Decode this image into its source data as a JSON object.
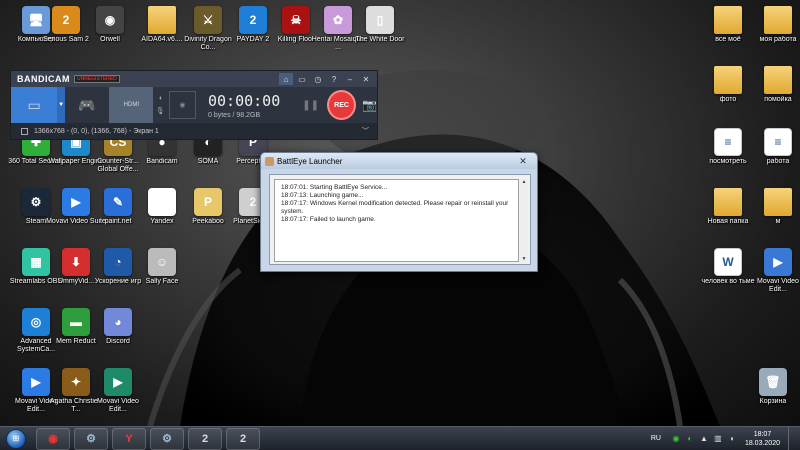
{
  "desktop": {
    "icons": [
      {
        "label": "Компьютер",
        "glyph": "🖥",
        "color": "#6a9bd8"
      },
      {
        "label": "Serious Sam 2",
        "glyph": "2",
        "color": "#d98a1b"
      },
      {
        "label": "Orwell",
        "glyph": "◉",
        "color": "#444"
      },
      {
        "label": "AIDA64.v6....",
        "glyph": "",
        "color": "#e0a930",
        "kind": "folder"
      },
      {
        "label": "Divinity Dragon Co...",
        "glyph": "⚔",
        "color": "#6b5a2a"
      },
      {
        "label": "PAYDAY 2",
        "glyph": "2",
        "color": "#1f7fd6"
      },
      {
        "label": "Killing Floor",
        "glyph": "☠",
        "color": "#a11"
      },
      {
        "label": "Hentai Mosaique ...",
        "glyph": "✿",
        "color": "#c89ad9"
      },
      {
        "label": "The White Door",
        "glyph": "▯",
        "color": "#ddd"
      },
      {
        "label": "все моё",
        "glyph": "",
        "color": "#e0a930",
        "kind": "folder"
      },
      {
        "label": "моя работа",
        "glyph": "",
        "color": "#e0a930",
        "kind": "folder"
      },
      {
        "label": "фото",
        "glyph": "",
        "color": "#e0a930",
        "kind": "folder"
      },
      {
        "label": "помойка",
        "glyph": "",
        "color": "#e0a930",
        "kind": "folder"
      },
      {
        "label": "360 Total Security",
        "glyph": "✚",
        "color": "#2fae3c"
      },
      {
        "label": "Wallpaper Engine",
        "glyph": "▣",
        "color": "#1e88c8"
      },
      {
        "label": "Counter-Str... Global Offe...",
        "glyph": "CS",
        "color": "#a6832b"
      },
      {
        "label": "Bandicam",
        "glyph": "●",
        "color": "#333"
      },
      {
        "label": "SOMA",
        "glyph": "◐",
        "color": "#222"
      },
      {
        "label": "Perception",
        "glyph": "P",
        "color": "#445"
      },
      {
        "label": "посмотреть",
        "glyph": "≡",
        "color": "#fff",
        "kind": "doc"
      },
      {
        "label": "работа",
        "glyph": "≡",
        "color": "#fff",
        "kind": "doc"
      },
      {
        "label": "Steam",
        "glyph": "⚙",
        "color": "#1b2838"
      },
      {
        "label": "Movavi Video Suite",
        "glyph": "▶",
        "color": "#2c7be5"
      },
      {
        "label": "paint.net",
        "glyph": "✎",
        "color": "#2a6fd8"
      },
      {
        "label": "Yandex",
        "glyph": "Y",
        "color": "#fff"
      },
      {
        "label": "Peekaboo",
        "glyph": "P",
        "color": "#e8c76b"
      },
      {
        "label": "PlanetSide 2",
        "glyph": "2",
        "color": "#cfcfcf"
      },
      {
        "label": "Новая папка",
        "glyph": "",
        "color": "#e0a930",
        "kind": "folder"
      },
      {
        "label": "м",
        "glyph": "",
        "color": "#e0a930",
        "kind": "folder"
      },
      {
        "label": "Streamlabs OBS",
        "glyph": "▦",
        "color": "#31c3a2"
      },
      {
        "label": "UmmyVid...",
        "glyph": "⬇",
        "color": "#d32f2f"
      },
      {
        "label": "Ускорение игр",
        "glyph": "◔",
        "color": "#1e5aa8"
      },
      {
        "label": "Sally Face",
        "glyph": "☺",
        "color": "#bbb"
      },
      {
        "label": "человек во тьме",
        "glyph": "W",
        "color": "#2b5797",
        "kind": "doc"
      },
      {
        "label": "Movavi Video Edit...",
        "glyph": "▶",
        "color": "#3a78d6"
      },
      {
        "label": "Advanced SystemCa...",
        "glyph": "◎",
        "color": "#1d7fd6"
      },
      {
        "label": "Mem Reduct",
        "glyph": "▬",
        "color": "#2e9d3c"
      },
      {
        "label": "Discord",
        "glyph": "◕",
        "color": "#7289da"
      },
      {
        "label": "Movavi Video Edit...",
        "glyph": "▶",
        "color": "#2c7be5"
      },
      {
        "label": "Agatha Christie - T...",
        "glyph": "✦",
        "color": "#8a5c1a"
      },
      {
        "label": "Movavi Video Edit...",
        "glyph": "▶",
        "color": "#1f8a6a"
      },
      {
        "label": "Корзина",
        "glyph": "🗑",
        "color": "#9ab"
      }
    ]
  },
  "bandicam": {
    "logo": "BANDICAM",
    "unregistered": "UNREGISTERED",
    "time": "00:00:00",
    "size": "0 bytes / 98.2GB",
    "rec_label": "REC",
    "capture_info": "1366x768 - (0, 0), (1366, 768) - Экран 1",
    "hdmi_label": "HDMI"
  },
  "battleye": {
    "title": "BattlEye Launcher",
    "log": [
      "18:07:01: Starting BattlEye Service...",
      "18:07:13: Launching game...",
      "18:07:17: Windows Kernel modification detected. Please repair or reinstall your system.",
      "18:07:17: Failed to launch game."
    ]
  },
  "taskbar": {
    "language": "RU",
    "time": "18:07",
    "date": "18.03.2020",
    "apps": [
      {
        "name": "bandicam",
        "glyph": "◉",
        "color": "#e33"
      },
      {
        "name": "steam",
        "glyph": "⚙",
        "color": "#9bc"
      },
      {
        "name": "yandex",
        "glyph": "Y",
        "color": "#f33"
      },
      {
        "name": "steam-2",
        "glyph": "⚙",
        "color": "#9bc"
      },
      {
        "name": "planetside",
        "glyph": "2",
        "color": "#ddd"
      },
      {
        "name": "planetside-2",
        "glyph": "2",
        "color": "#ddd"
      }
    ]
  }
}
